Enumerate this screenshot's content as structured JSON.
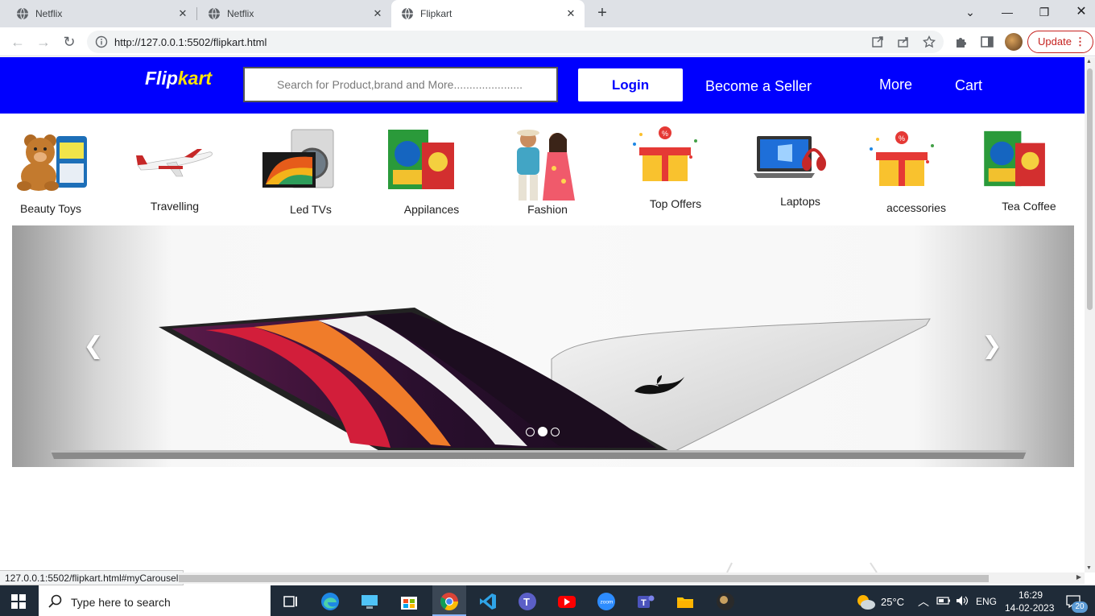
{
  "browser": {
    "tabs": [
      {
        "title": "Netflix",
        "active": false
      },
      {
        "title": "Netflix",
        "active": false
      },
      {
        "title": "Flipkart",
        "active": true
      }
    ],
    "url": "http://127.0.0.1:5502/flipkart.html",
    "update_label": "Update",
    "status_url": "127.0.0.1:5502/flipkart.html#myCarousel"
  },
  "header": {
    "logo_flip": "Flip",
    "logo_kart": "kart",
    "search_placeholder": "Search for Product,brand and More......................",
    "login_label": "Login",
    "seller_label": "Become a Seller",
    "more_label": "More",
    "cart_label": "Cart"
  },
  "categories": [
    {
      "label": "Beauty Toys",
      "icon": "teddy-bear-icon"
    },
    {
      "label": "Travelling",
      "icon": "airplane-icon"
    },
    {
      "label": "Led TVs",
      "icon": "tv-washing-machine-icon"
    },
    {
      "label": "Appilances",
      "icon": "detergent-icon"
    },
    {
      "label": "Fashion",
      "icon": "fashion-couple-icon"
    },
    {
      "label": "Top Offers",
      "icon": "gift-offer-icon"
    },
    {
      "label": "Laptops",
      "icon": "laptop-headphones-icon"
    },
    {
      "label": "accessories",
      "icon": "gift-offer-icon"
    },
    {
      "label": "Tea Coffee",
      "icon": "detergent-icon"
    }
  ],
  "carousel": {
    "slide_count": 3,
    "active_index": 1,
    "prev_icon": "chevron-left-icon",
    "next_icon": "chevron-right-icon"
  },
  "taskbar": {
    "search_placeholder": "Type here to search",
    "weather": "25°C",
    "language": "ENG",
    "time": "16:29",
    "date": "14-02-2023",
    "notification_count": "20"
  },
  "colors": {
    "brand_blue": "#0000fe",
    "logo_yellow": "#ffe500",
    "update_red": "#c5221f"
  }
}
